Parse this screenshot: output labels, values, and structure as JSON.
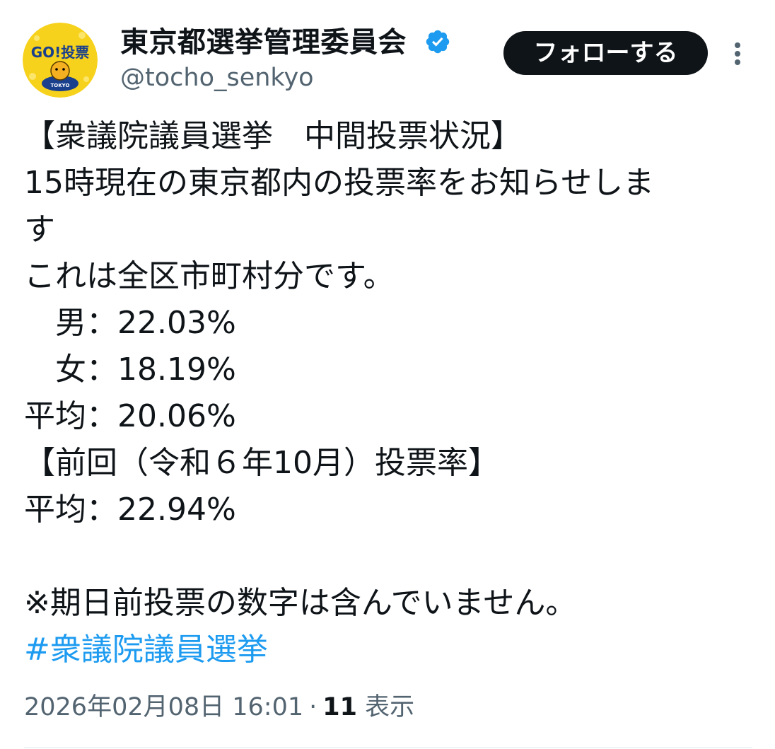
{
  "author": {
    "display_name": "東京都選挙管理委員会",
    "handle": "@tocho_senkyo",
    "verified": true,
    "avatar_text": "GO!投票",
    "avatar_subtext": "TOKYO"
  },
  "actions": {
    "follow_label": "フォローする",
    "more_icon": "more-vertical-icon"
  },
  "tweet": {
    "lines": [
      "【衆議院議員選挙　中間投票状況】",
      "15時現在の東京都内の投票率をお知らせしま",
      "す",
      "これは全区市町村分です。",
      "　男：22.03%",
      "　女：18.19%",
      "平均：20.06%",
      "【前回（令和６年10月）投票率】",
      "平均：22.94%",
      "",
      "※期日前投票の数字は含んでいません。"
    ],
    "hashtag": "#衆議院議員選挙"
  },
  "meta": {
    "timestamp": "2026年02月08日 16:01",
    "separator": "·",
    "views_count": "11",
    "views_label": "表示"
  },
  "colors": {
    "text_primary": "#0f1419",
    "text_secondary": "#536471",
    "link": "#1d9bf0",
    "verified_badge": "#1d9bf0",
    "avatar_background": "#f7d21c",
    "follow_button_bg": "#0f1419"
  }
}
